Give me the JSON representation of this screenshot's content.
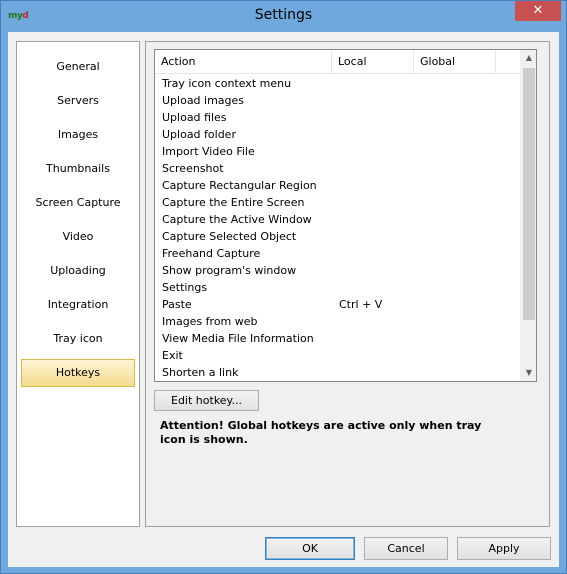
{
  "window": {
    "title": "Settings",
    "app_icon_text": [
      "m",
      "y",
      "d"
    ],
    "close_glyph": "✕"
  },
  "nav": {
    "items": [
      {
        "label": "General"
      },
      {
        "label": "Servers"
      },
      {
        "label": "Images"
      },
      {
        "label": "Thumbnails"
      },
      {
        "label": "Screen Capture"
      },
      {
        "label": "Video"
      },
      {
        "label": "Uploading"
      },
      {
        "label": "Integration"
      },
      {
        "label": "Tray icon"
      },
      {
        "label": "Hotkeys",
        "selected": true
      }
    ]
  },
  "hotkeys": {
    "columns": {
      "action": "Action",
      "local": "Local",
      "global": "Global"
    },
    "rows": [
      {
        "action": "Tray icon context menu",
        "local": "",
        "global": ""
      },
      {
        "action": "Upload images",
        "local": "",
        "global": ""
      },
      {
        "action": "Upload files",
        "local": "",
        "global": ""
      },
      {
        "action": "Upload folder",
        "local": "",
        "global": ""
      },
      {
        "action": "Import Video File",
        "local": "",
        "global": ""
      },
      {
        "action": "Screenshot",
        "local": "",
        "global": ""
      },
      {
        "action": "Capture Rectangular Region",
        "local": "",
        "global": ""
      },
      {
        "action": "Capture the Entire Screen",
        "local": "",
        "global": ""
      },
      {
        "action": "Capture the Active Window",
        "local": "",
        "global": ""
      },
      {
        "action": "Capture Selected Object",
        "local": "",
        "global": ""
      },
      {
        "action": "Freehand Capture",
        "local": "",
        "global": ""
      },
      {
        "action": "Show program's window",
        "local": "",
        "global": ""
      },
      {
        "action": "Settings",
        "local": "",
        "global": ""
      },
      {
        "action": "Paste",
        "local": "Ctrl + V",
        "global": ""
      },
      {
        "action": "Images from web",
        "local": "",
        "global": ""
      },
      {
        "action": "View Media File Information",
        "local": "",
        "global": ""
      },
      {
        "action": "Exit",
        "local": "",
        "global": ""
      },
      {
        "action": "Shorten a link",
        "local": "",
        "global": ""
      }
    ],
    "scroll_up_glyph": "▲",
    "scroll_down_glyph": "▼",
    "edit_button": "Edit hotkey...",
    "attention": "Attention! Global hotkeys are active only when tray icon is shown."
  },
  "buttons": {
    "ok": "OK",
    "cancel": "Cancel",
    "apply": "Apply"
  },
  "colors": {
    "titlebar": "#6fa8dc",
    "close": "#c75050",
    "selected_nav": "#f3dc8c"
  }
}
